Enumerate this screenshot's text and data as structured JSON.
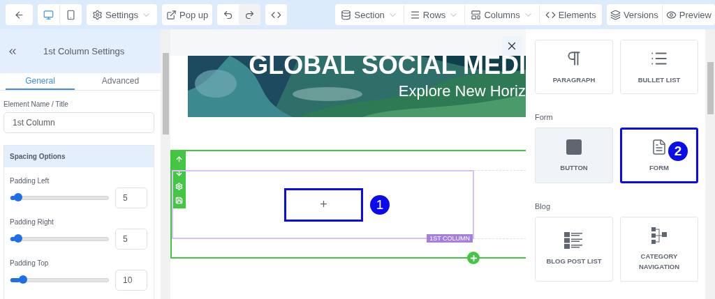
{
  "toolbar": {
    "devices": [
      {
        "selected": true
      },
      {
        "selected": false
      }
    ],
    "settings": "Settings",
    "popup": "Pop up",
    "structure": [
      "Section",
      "Rows",
      "Columns"
    ],
    "elements": "Elements",
    "versions": "Versions",
    "preview": "Preview"
  },
  "settings_panel": {
    "title": "1st Column Settings",
    "tabs": [
      {
        "label": "General",
        "selected": true
      },
      {
        "label": "Advanced",
        "selected": false
      }
    ],
    "name_label": "Element Name / Title",
    "name_value": "1st Column",
    "spacing": {
      "heading": "Spacing Options",
      "sliders": [
        {
          "label": "Padding Left",
          "level": 0.05,
          "value": "5"
        },
        {
          "label": "Padding Right",
          "level": 0.05,
          "value": "5"
        },
        {
          "label": "Padding Top",
          "level": 0.1,
          "value": "10"
        }
      ]
    }
  },
  "canvas": {
    "banner": {
      "title": "GLOBAL SOCIAL MEDI",
      "subtitle": "Explore New Horiz"
    },
    "column_label": "1ST COLUMN",
    "add_symbol": "+",
    "annotation": "1"
  },
  "elements_panel": {
    "groups": [
      {
        "items": [
          {
            "label": "PARAGRAPH",
            "hovered": false
          },
          {
            "label": "BULLET LIST",
            "hovered": false
          }
        ]
      },
      {
        "heading": "Form",
        "items": [
          {
            "label": "BUTTON",
            "hovered": true
          },
          {
            "label": "FORM",
            "hovered": false,
            "annotation": "2"
          }
        ]
      },
      {
        "heading": "Blog",
        "items": [
          {
            "label": "BLOG POST LIST",
            "hovered": false
          },
          {
            "label": "CATEGORY NAVIGATION",
            "hovered": false
          }
        ]
      }
    ]
  }
}
